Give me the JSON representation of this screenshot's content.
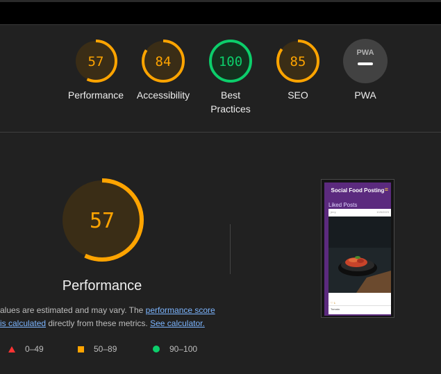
{
  "colors": {
    "background": "#212121",
    "pass": "#0cce6b",
    "average": "#ffa400",
    "fail": "#ff3333",
    "link": "#7cb5ff",
    "pwa_gray": "#424242"
  },
  "gauges": [
    {
      "name": "performance",
      "score": "57",
      "score_value": 57,
      "label": "Performance",
      "status": "average"
    },
    {
      "name": "accessibility",
      "score": "84",
      "score_value": 84,
      "label": "Accessibility",
      "status": "average"
    },
    {
      "name": "best-practices",
      "score": "100",
      "score_value": 100,
      "label_line1": "Best",
      "label_line2": "Practices",
      "status": "pass"
    },
    {
      "name": "seo",
      "score": "85",
      "score_value": 85,
      "label": "SEO",
      "status": "average"
    },
    {
      "name": "pwa",
      "badge": "PWA",
      "label": "PWA",
      "status": "na",
      "icon": "pwa-badge-icon"
    }
  ],
  "main": {
    "score": "57",
    "score_value": 57,
    "title": "Performance",
    "note": {
      "prefix": "alues are estimated and may vary. The ",
      "link1": "performance score",
      "link1b": "is calculated",
      "middle": " directly from these metrics. ",
      "link2": "See calculator."
    },
    "legend": [
      {
        "icon": "fail-triangle-icon",
        "range": "0–49"
      },
      {
        "icon": "average-square-icon",
        "range": "50–89"
      },
      {
        "icon": "pass-circle-icon",
        "range": "90–100"
      }
    ]
  },
  "screenshot": {
    "app_title": "Social Food Posting",
    "menu_icon": "hamburger-menu-icon",
    "subtitle": "Liked Posts",
    "post_user": "jerry",
    "post_date": "10/6/2023",
    "post_likes": "♡ 1",
    "post_caption": "Tomato"
  }
}
